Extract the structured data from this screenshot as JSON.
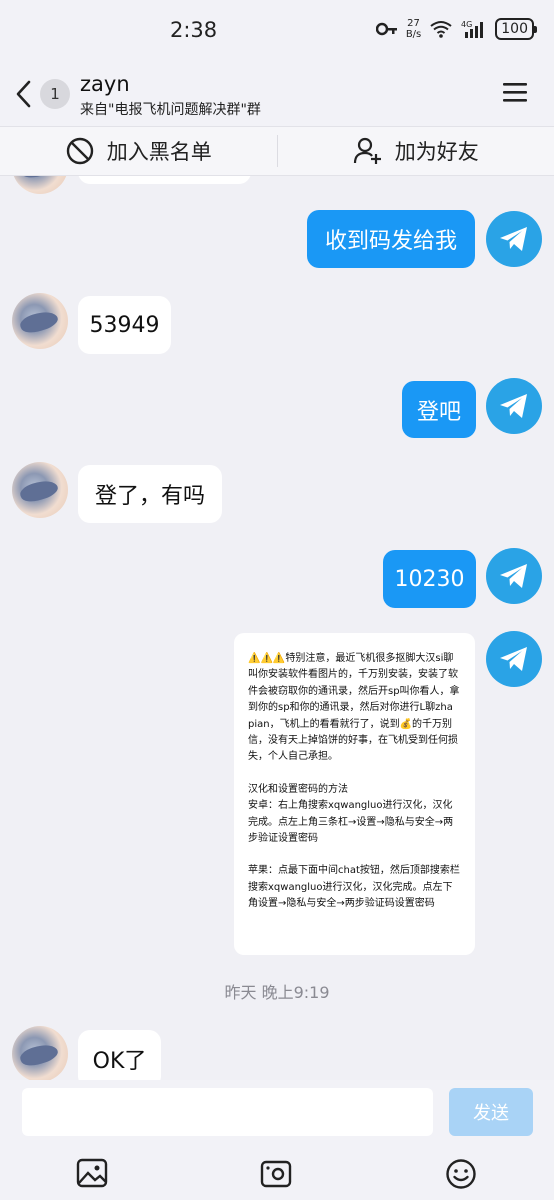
{
  "status_bar": {
    "time": "2:38",
    "net_speed_value": "27",
    "net_speed_unit": "B/s",
    "signal_label": "4G",
    "battery": "100"
  },
  "header": {
    "back_count": "1",
    "title": "zayn",
    "subtitle": "来自\"电报飞机问题解决群\"群",
    "menu_icon": "hamburger-menu-icon"
  },
  "actions": {
    "block": "加入黑名单",
    "add_friend": "加为好友"
  },
  "messages": [
    {
      "side": "out",
      "text": "收到码发给我"
    },
    {
      "side": "in",
      "text": "53949"
    },
    {
      "side": "out",
      "text": "登吧"
    },
    {
      "side": "in",
      "text": "登了，有吗"
    },
    {
      "side": "out",
      "text": "10230"
    },
    {
      "side": "in",
      "text": "OK了"
    }
  ],
  "notice": {
    "paragraph1": "⚠️⚠️⚠️特别注意，最近飞机很多抠脚大汉si聊叫你安装软件看图片的，千万别安装，安装了软件会被窃取你的通讯录，然后开sp叫你看人，拿到你的sp和你的通讯录，然后对你进行L聊zha pian，飞机上的看看就行了，说到💰的千万别信，没有天上掉馅饼的好事，在飞机受到任何损失，个人自己承担。",
    "paragraph2": "汉化和设置密码的方法\n安卓：右上角搜索xqwangluo进行汉化，汉化完成。点左上角三条杠→设置→隐私与安全→两步验证设置密码",
    "paragraph3": "苹果：点最下面中间chat按钮，然后顶部搜索栏搜索xqwangluo进行汉化，汉化完成。点左下角设置→隐私与安全→两步验证码设置密码"
  },
  "date_separator": "昨天 晚上9:19",
  "input": {
    "placeholder": "",
    "send_label": "发送"
  },
  "colors": {
    "outgoing_bubble": "#1a98f5",
    "send_disabled": "#a9d3f6",
    "telegram_avatar": "#2aa3e6"
  }
}
